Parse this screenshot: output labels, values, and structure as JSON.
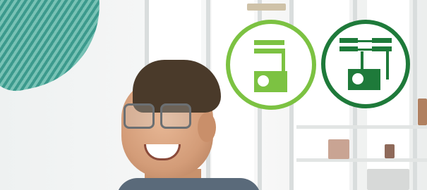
{
  "colors": {
    "accent_light_green": "#7cc242",
    "accent_dark_green": "#1e7a3a",
    "icon_fill_white": "#ffffff",
    "sleeve_teal": "#3c9a8d"
  },
  "icons": {
    "single_unit": "single-shelf-unit-icon",
    "linked_units": "linked-shelf-units-icon"
  }
}
